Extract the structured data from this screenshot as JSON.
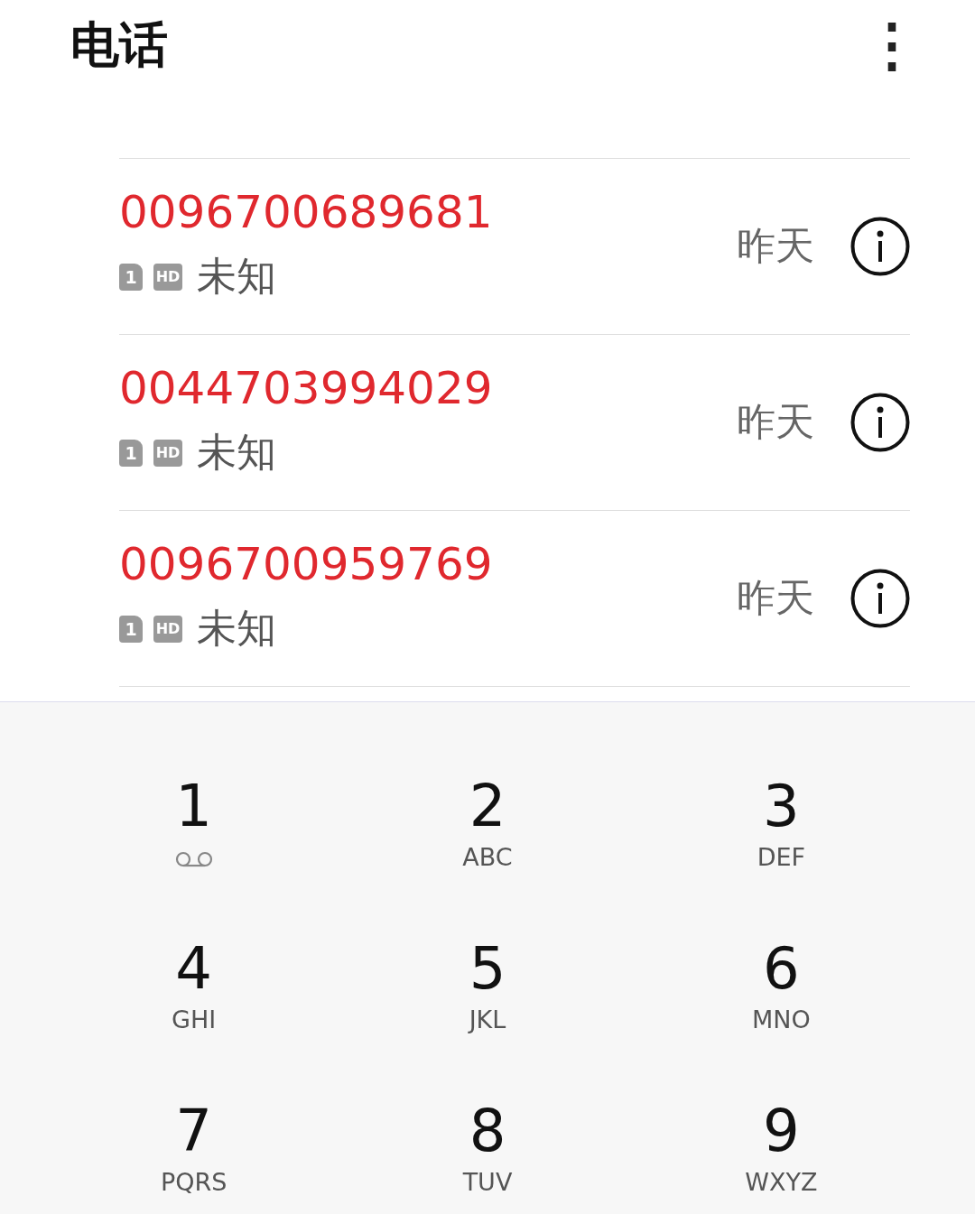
{
  "header": {
    "title": "电话",
    "menu_icon": "⋮"
  },
  "calls": [
    {
      "number": "0096700689681",
      "sim": "1",
      "quality": "HD",
      "location": "未知",
      "date": "昨天",
      "missed": true
    },
    {
      "number": "0044703994029",
      "sim": "1",
      "quality": "HD",
      "location": "未知",
      "date": "昨天",
      "missed": true
    },
    {
      "number": "0096700959769",
      "sim": "1",
      "quality": "HD",
      "location": "未知",
      "date": "昨天",
      "missed": true
    }
  ],
  "dialpad": [
    {
      "digit": "1",
      "kind": "voicemail"
    },
    {
      "digit": "2",
      "kind": "letters",
      "letters": "ABC"
    },
    {
      "digit": "3",
      "kind": "letters",
      "letters": "DEF"
    },
    {
      "digit": "4",
      "kind": "letters",
      "letters": "GHI"
    },
    {
      "digit": "5",
      "kind": "letters",
      "letters": "JKL"
    },
    {
      "digit": "6",
      "kind": "letters",
      "letters": "MNO"
    },
    {
      "digit": "7",
      "kind": "letters",
      "letters": "PQRS"
    },
    {
      "digit": "8",
      "kind": "letters",
      "letters": "TUV"
    },
    {
      "digit": "9",
      "kind": "letters",
      "letters": "WXYZ"
    }
  ]
}
